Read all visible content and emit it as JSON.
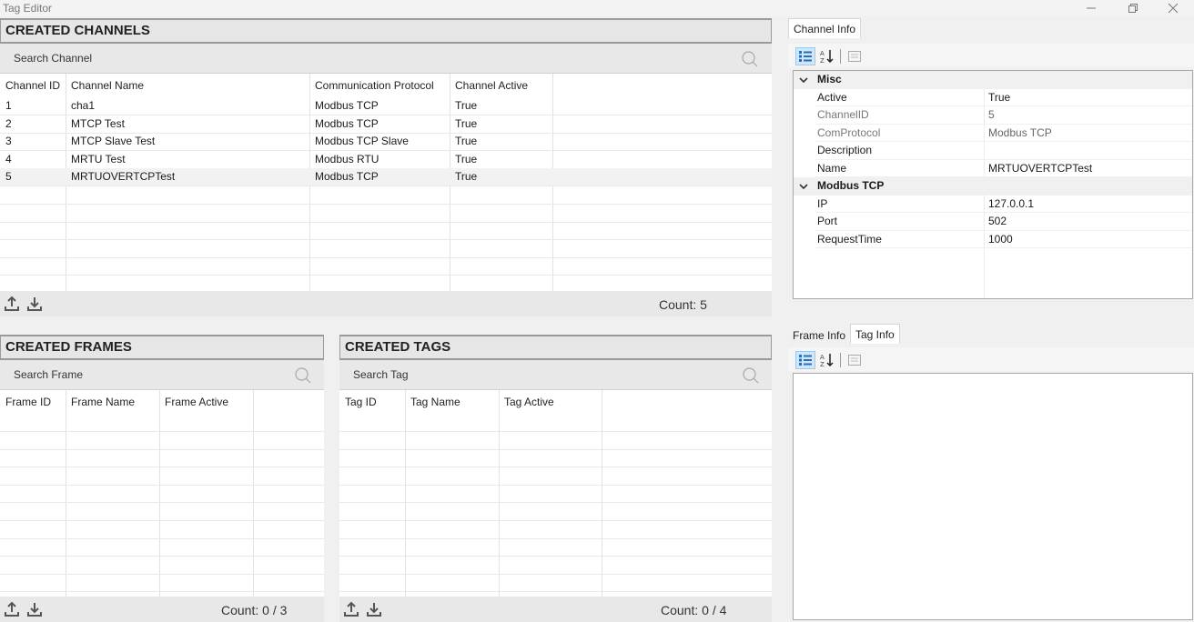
{
  "window": {
    "title": "Tag Editor"
  },
  "channels": {
    "title": "CREATED CHANNELS",
    "search_placeholder": "Search Channel",
    "columns": [
      "Channel ID",
      "Channel Name",
      "Communication Protocol",
      "Channel Active"
    ],
    "rows": [
      [
        "1",
        "cha1",
        "Modbus TCP",
        "True"
      ],
      [
        "2",
        "MTCP Test",
        "Modbus TCP",
        "True"
      ],
      [
        "3",
        "MTCP Slave Test",
        "Modbus TCP Slave",
        "True"
      ],
      [
        "4",
        "MRTU Test",
        "Modbus RTU",
        "True"
      ],
      [
        "5",
        "MRTUOVERTCPTest",
        "Modbus TCP",
        "True"
      ]
    ],
    "selected_index": 4,
    "count": "Count: 5"
  },
  "frames": {
    "title": "CREATED FRAMES",
    "search_placeholder": "Search Frame",
    "columns": [
      "Frame ID",
      "Frame Name",
      "Frame Active"
    ],
    "count": "Count: 0 / 3"
  },
  "tags": {
    "title": "CREATED TAGS",
    "search_placeholder": "Search Tag",
    "columns": [
      "Tag ID",
      "Tag Name",
      "Tag Active"
    ],
    "count": "Count: 0 / 4"
  },
  "channel_info": {
    "tab": "Channel Info",
    "categories": [
      {
        "name": "Misc",
        "props": [
          {
            "name": "Active",
            "value": "True",
            "readonly": false
          },
          {
            "name": "ChannelID",
            "value": "5",
            "readonly": true
          },
          {
            "name": "ComProtocol",
            "value": "Modbus TCP",
            "readonly": true
          },
          {
            "name": "Description",
            "value": "",
            "readonly": false
          },
          {
            "name": "Name",
            "value": "MRTUOVERTCPTest",
            "readonly": false
          }
        ]
      },
      {
        "name": "Modbus TCP",
        "props": [
          {
            "name": "IP",
            "value": "127.0.0.1",
            "readonly": false
          },
          {
            "name": "Port",
            "value": "502",
            "readonly": false
          },
          {
            "name": "RequestTime",
            "value": "1000",
            "readonly": false
          }
        ]
      }
    ]
  },
  "lower_info": {
    "tabs": [
      "Frame Info",
      "Tag Info"
    ],
    "active_tab": 1
  },
  "icons": {
    "upload": "upload-icon",
    "download": "download-icon",
    "search": "search-icon",
    "categorized": "categorized-view-icon",
    "alphabetical": "sort-az-icon",
    "property_pages": "property-pages-icon"
  }
}
